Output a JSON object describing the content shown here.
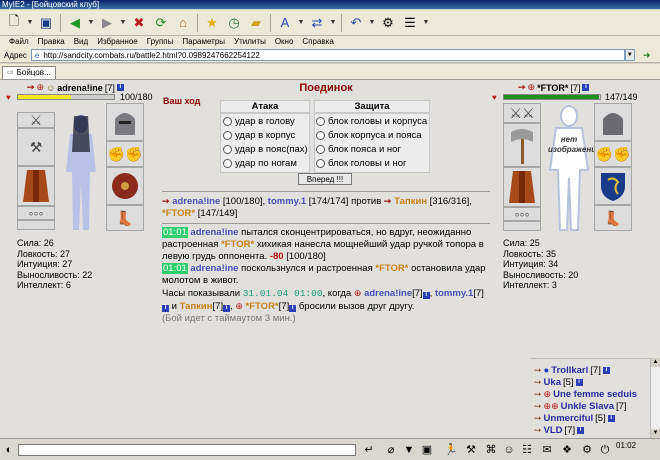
{
  "window": {
    "title": "MyIE2 - [Бойцовский клуб]"
  },
  "toolbar": {
    "icons": [
      "new-page-icon",
      "save-icon",
      "back-icon",
      "forward-icon",
      "stop-icon",
      "refresh-icon",
      "home-icon",
      "favorites-icon",
      "history-icon",
      "folder-icon",
      "font-icon",
      "translate-icon",
      "undo-icon",
      "tools-icon",
      "options-icon"
    ]
  },
  "menu": [
    "Файл",
    "Правка",
    "Вид",
    "Избранное",
    "Группы",
    "Параметры",
    "Утилиты",
    "Окно",
    "Справка"
  ],
  "address": {
    "label": "Адрес",
    "url": "http://sandcity.combats.ru/battle2.html?0.0989247662254122"
  },
  "tab": {
    "label": "Бойцов..."
  },
  "battle": {
    "title": "Поединок",
    "your_turn": "Ваш ход",
    "player": {
      "name": "adrena!ine",
      "level": "[7]",
      "hp": "100/180",
      "hp_fraction": 0.556,
      "hp_color": "#f5e81f",
      "stats": [
        "Сила: 26",
        "Ловкость: 27",
        "Интуиция: 27",
        "Выносливость: 22",
        "Интеллект: 6"
      ]
    },
    "enemy": {
      "name": "*FTOR*",
      "level": "[7]",
      "hp": "147/149",
      "hp_fraction": 0.987,
      "hp_color": "#1f8f1f",
      "no_image": "нет изображения",
      "stats": [
        "Сила: 25",
        "Ловкость: 35",
        "Интуиция: 34",
        "Выносливость: 20",
        "Интеллект: 3"
      ]
    },
    "attack": {
      "header": "Атака",
      "options": [
        "удар в голову",
        "удар в корпус",
        "удар в пояс(пах)",
        "удар по ногам"
      ]
    },
    "defense": {
      "header": "Защита",
      "options": [
        "блок головы и корпуса",
        "блок корпуса и пояса",
        "блок пояса и ног",
        "блок головы и ног"
      ]
    },
    "forward_button": "Вперед !!!",
    "vs": {
      "left1_name": "adrena!ine",
      "left1_hp": "[100/180],",
      "left2_name": "tommy.1",
      "left2_hp": "[174/174]",
      "against": "против",
      "right1_name": "Тапкин",
      "right1_hp": "[316/316],",
      "right2_name": "*FTOR*",
      "right2_hp": "[147/149]"
    },
    "log": {
      "e1_time": "01:01",
      "e1_name": "adrena!ine",
      "e1_text": "пытался сконцентрироваться, но вдруг, неожиданно растроенная",
      "e1_enemy": "*FTOR*",
      "e1_text2": "хихикая нанесла мощнейший удар ручкой топора в левую грудь оппонента.",
      "e1_dmg": "-80",
      "e1_hp": "[100/180]",
      "e2_time": "01:01",
      "e2_name": "adrena!ine",
      "e2_text": "поскользнулся и растроенная",
      "e2_enemy": "*FTOR*",
      "e2_text2": "остановила удар молотом в живот.",
      "e3_prefix": "Часы показывали",
      "e3_time": "31.01.04 01:00",
      "e3_when": ", когда",
      "e3_n1": "adrena!ine",
      "e3_l1": "[7]",
      "e3_n2": "tommy.1",
      "e3_l2": "[7]",
      "e3_and": "и",
      "e3_n3": "Тапкин",
      "e3_l3": "[7]",
      "e3_n4": "*FTOR*",
      "e3_l4": "[7]",
      "e3_text": "бросили вызов друг другу.",
      "e4": "(Бой идет с таймаутом 3 мин.)"
    }
  },
  "online": [
    {
      "name": "Trollkarl",
      "level": "[7]"
    },
    {
      "name": "Uka",
      "level": "[5]"
    },
    {
      "name": "Une femme seduis",
      "level": ""
    },
    {
      "name": "Unkle Slava",
      "level": "[7]"
    },
    {
      "name": "Unmerciful",
      "level": "[5]"
    },
    {
      "name": "VLD",
      "level": "[7]"
    }
  ],
  "clock": {
    "time": "01:02",
    "label": ""
  },
  "colors": {
    "accent_red": "#8b0000",
    "nick_blue": "#4a4fb8",
    "nick_orange": "#c88014"
  }
}
